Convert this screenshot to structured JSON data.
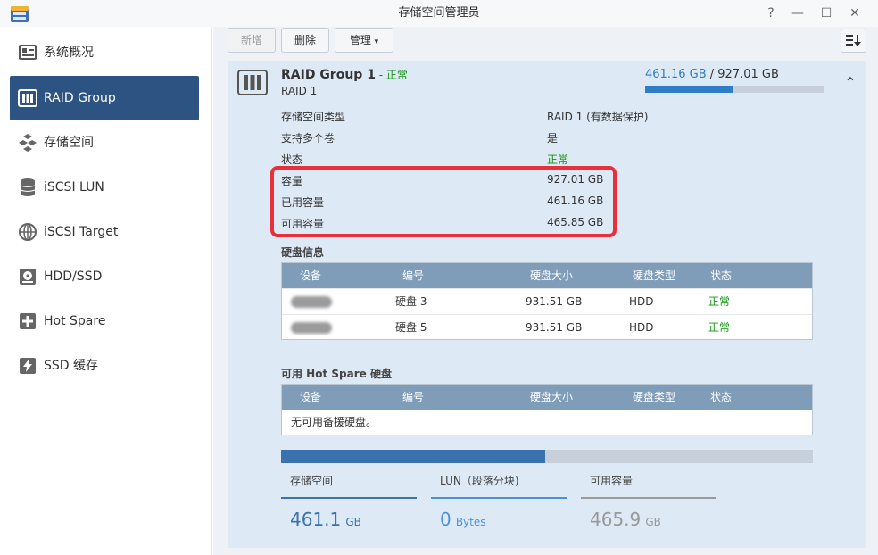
{
  "window": {
    "title": "存储空间管理员",
    "controls": [
      "?",
      "—",
      "☐",
      "✕"
    ]
  },
  "sidebar": {
    "items": [
      {
        "label": "系统概况",
        "icon": "overview-icon"
      },
      {
        "label": "RAID Group",
        "icon": "raid-group-icon",
        "active": true
      },
      {
        "label": "存储空间",
        "icon": "storage-space-icon"
      },
      {
        "label": "iSCSI LUN",
        "icon": "iscsi-lun-icon"
      },
      {
        "label": "iSCSI Target",
        "icon": "iscsi-target-icon"
      },
      {
        "label": "HDD/SSD",
        "icon": "hdd-ssd-icon"
      },
      {
        "label": "Hot Spare",
        "icon": "hot-spare-icon"
      },
      {
        "label": "SSD 缓存",
        "icon": "ssd-cache-icon"
      }
    ]
  },
  "toolbar": {
    "create": "新增",
    "delete": "删除",
    "manage": "管理",
    "manage_caret": "▾"
  },
  "raid": {
    "name": "RAID Group 1",
    "status_sep": " - ",
    "status": "正常",
    "type": "RAID 1",
    "usage_used": "461.16 GB",
    "usage_total": "927.01 GB",
    "usage_sep": " / ",
    "usage_fraction": 0.497,
    "collapse_glyph": "⌃"
  },
  "details": [
    {
      "label": "存储空间类型",
      "value": "RAID 1 (有数据保护)"
    },
    {
      "label": "支持多个卷",
      "value": "是"
    },
    {
      "label": "状态",
      "value": "正常",
      "ok": true
    },
    {
      "label": "容量",
      "value": "927.01 GB"
    },
    {
      "label": "已用容量",
      "value": "461.16 GB"
    },
    {
      "label": "可用容量",
      "value": "465.85 GB"
    }
  ],
  "disk_info": {
    "title": "硬盘信息",
    "columns": [
      "设备",
      "编号",
      "硬盘大小",
      "硬盘类型",
      "状态"
    ],
    "rows": [
      {
        "number": "硬盘 3",
        "size": "931.51 GB",
        "type": "HDD",
        "status": "正常"
      },
      {
        "number": "硬盘 5",
        "size": "931.51 GB",
        "type": "HDD",
        "status": "正常"
      }
    ]
  },
  "hot_spare": {
    "title": "可用 Hot Spare 硬盘",
    "columns": [
      "设备",
      "编号",
      "硬盘大小",
      "硬盘类型",
      "状态"
    ],
    "empty": "无可用备援硬盘。"
  },
  "allocation": {
    "storage_fraction": 0.497,
    "stats": [
      {
        "label": "存储空间",
        "value": "461.1",
        "unit": "GB",
        "color": "#3a72b0"
      },
      {
        "label": "LUN（段落分块)",
        "value": "0",
        "unit": "Bytes",
        "color": "#4a94d6"
      },
      {
        "label": "可用容量",
        "value": "465.9",
        "unit": "GB",
        "color": "#999999"
      }
    ]
  },
  "colors": {
    "accent": "#2d5382",
    "ok": "#149414",
    "highlight": "#e8303a",
    "bar_fill": "#2f7cc8",
    "bar_bg": "#c7d0da"
  }
}
